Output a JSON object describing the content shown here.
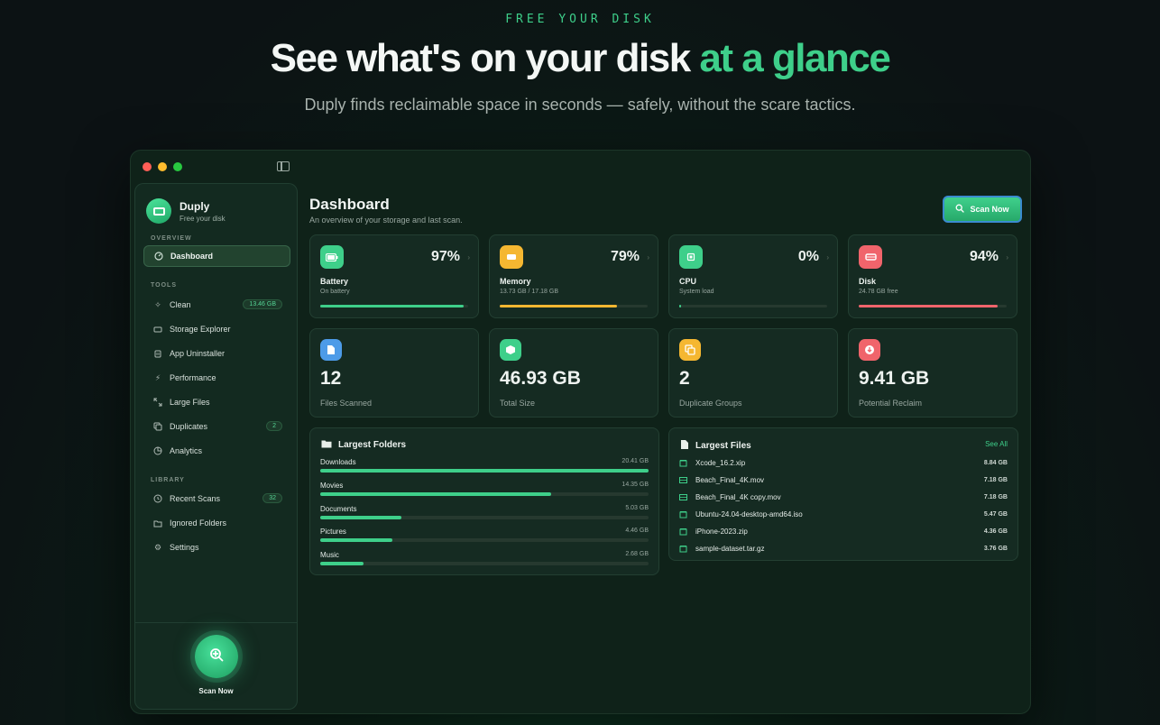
{
  "hero": {
    "eyebrow": "FREE YOUR DISK",
    "title_main": "See what's on your disk ",
    "title_accent": "at a glance",
    "subtitle": "Duply finds reclaimable space in seconds — safely, without the scare tactics."
  },
  "colors": {
    "accent": "#3ecf8a",
    "battery": "#3ecf8a",
    "memory": "#f5b731",
    "cpu": "#3ecf8a",
    "disk": "#f0646b"
  },
  "sidebar": {
    "brand_name": "Duply",
    "brand_tagline": "Free your disk",
    "sections": {
      "overview": "OVERVIEW",
      "tools": "TOOLS",
      "library": "LIBRARY"
    },
    "items": [
      {
        "label": "Dashboard",
        "icon": "dashboard-icon",
        "badge": ""
      },
      {
        "label": "Clean",
        "icon": "sparkles-icon",
        "badge": "13.46 GB"
      },
      {
        "label": "Storage Explorer",
        "icon": "drive-icon",
        "badge": ""
      },
      {
        "label": "App Uninstaller",
        "icon": "trash-icon",
        "badge": ""
      },
      {
        "label": "Performance",
        "icon": "bolt-icon",
        "badge": ""
      },
      {
        "label": "Large Files",
        "icon": "expand-icon",
        "badge": ""
      },
      {
        "label": "Duplicates",
        "icon": "copy-icon",
        "badge": "2"
      },
      {
        "label": "Analytics",
        "icon": "pie-chart-icon",
        "badge": ""
      },
      {
        "label": "Recent Scans",
        "icon": "history-icon",
        "badge": "32"
      },
      {
        "label": "Ignored Folders",
        "icon": "folder-ignore-icon",
        "badge": ""
      },
      {
        "label": "Settings",
        "icon": "gear-icon",
        "badge": ""
      }
    ],
    "scan_label": "Scan Now"
  },
  "main": {
    "title": "Dashboard",
    "subtitle": "An overview of your storage and last scan.",
    "scan_button": "Scan Now"
  },
  "stats": [
    {
      "name": "Battery",
      "sub": "On battery",
      "percent_text": "97%",
      "percent": 97,
      "icon": "battery-icon"
    },
    {
      "name": "Memory",
      "sub": "13.73 GB / 17.18 GB",
      "percent_text": "79%",
      "percent": 79,
      "icon": "memory-icon"
    },
    {
      "name": "CPU",
      "sub": "System load",
      "percent_text": "0%",
      "percent": 0,
      "icon": "cpu-icon"
    },
    {
      "name": "Disk",
      "sub": "24.78 GB free",
      "percent_text": "94%",
      "percent": 94,
      "icon": "disk-icon"
    }
  ],
  "summary": [
    {
      "value": "12",
      "label": "Files Scanned",
      "icon": "document-icon"
    },
    {
      "value": "46.93 GB",
      "label": "Total Size",
      "icon": "box-icon"
    },
    {
      "value": "2",
      "label": "Duplicate Groups",
      "icon": "duplicate-icon"
    },
    {
      "value": "9.41 GB",
      "label": "Potential Reclaim",
      "icon": "download-icon"
    }
  ],
  "largest_folders": {
    "title": "Largest Folders",
    "rows": [
      {
        "name": "Downloads",
        "size": "20.41 GB",
        "fraction": 1.0
      },
      {
        "name": "Movies",
        "size": "14.35 GB",
        "fraction": 0.703
      },
      {
        "name": "Documents",
        "size": "5.03 GB",
        "fraction": 0.246
      },
      {
        "name": "Pictures",
        "size": "4.46 GB",
        "fraction": 0.219
      },
      {
        "name": "Music",
        "size": "2.68 GB",
        "fraction": 0.131
      }
    ]
  },
  "largest_files": {
    "title": "Largest Files",
    "see_all": "See All",
    "rows": [
      {
        "name": "Xcode_16.2.xip",
        "size": "8.84 GB",
        "icon": "archive-icon"
      },
      {
        "name": "Beach_Final_4K.mov",
        "size": "7.18 GB",
        "icon": "film-icon"
      },
      {
        "name": "Beach_Final_4K copy.mov",
        "size": "7.18 GB",
        "icon": "film-icon"
      },
      {
        "name": "Ubuntu-24.04-desktop-amd64.iso",
        "size": "5.47 GB",
        "icon": "archive-icon"
      },
      {
        "name": "iPhone-2023.zip",
        "size": "4.36 GB",
        "icon": "archive-icon"
      },
      {
        "name": "sample-dataset.tar.gz",
        "size": "3.76 GB",
        "icon": "archive-icon"
      }
    ]
  }
}
